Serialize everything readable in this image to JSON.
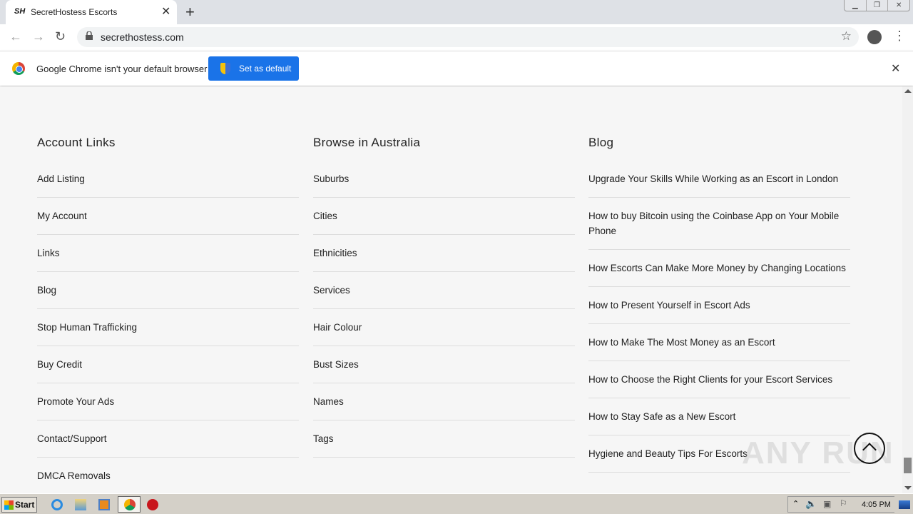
{
  "browser": {
    "tab_favicon": "SH",
    "tab_title": "SecretHostess Escorts",
    "url": "secrethostess.com",
    "infobar_text": "Google Chrome isn't your default browser",
    "set_default_label": "Set as default"
  },
  "footer": {
    "columns": [
      {
        "heading": "Account Links",
        "items": [
          "Add Listing",
          "My Account",
          "Links",
          "Blog",
          "Stop Human Trafficking",
          "Buy Credit",
          "Promote Your Ads",
          "Contact/Support",
          "DMCA Removals"
        ]
      },
      {
        "heading": "Browse in Australia",
        "items": [
          "Suburbs",
          "Cities",
          "Ethnicities",
          "Services",
          "Hair Colour",
          "Bust Sizes",
          "Names",
          "Tags"
        ]
      },
      {
        "heading": "Blog",
        "items": [
          "Upgrade Your Skills While Working as an Escort in London",
          "How to buy Bitcoin using the Coinbase App on Your Mobile Phone",
          "How Escorts Can Make More Money by Changing Locations",
          "How to Present Yourself in Escort Ads",
          "How to Make The Most Money as an Escort",
          "How to Choose the Right Clients for your Escort Services",
          "How to Stay Safe as a New Escort",
          "Hygiene and Beauty Tips For Escorts"
        ]
      }
    ]
  },
  "watermark": "ANY RUN",
  "taskbar": {
    "start_label": "Start",
    "clock": "4:05 PM"
  }
}
